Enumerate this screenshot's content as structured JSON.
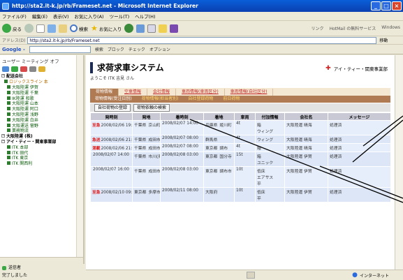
{
  "window": {
    "title": "http://sta2.it-k.jp/rb/Frameset.net - Microsoft Internet Explorer",
    "buttons": [
      "_",
      "□",
      "×"
    ]
  },
  "menu": [
    "ファイル(F)",
    "編集(E)",
    "表示(V)",
    "お気に入り(A)",
    "ツール(T)",
    "ヘルプ(H)"
  ],
  "toolbar": {
    "back": "戻る",
    "search": "検索",
    "favorites": "お気に入り",
    "right_links": [
      "リンク",
      "HotMail の無料サービス",
      "Windows"
    ]
  },
  "address": {
    "label": "アドレス(D)",
    "url": "http://sta2.it-k.jp/rb/Frameset.net",
    "go": "移動"
  },
  "googlebar": {
    "logo": "Google -",
    "items": [
      "検索",
      "ブロック",
      "チェック",
      "オプション"
    ]
  },
  "left": {
    "header": "ユーザー ミーティング オフ",
    "tree": [
      {
        "label": "配送会社",
        "level": 0,
        "root": true
      },
      {
        "label": "ロジックスライン 本",
        "level": 1,
        "sel": true
      },
      {
        "label": "大阪陸運 伊賀",
        "level": 2
      },
      {
        "label": "大阪陸運 千葉",
        "level": 2
      },
      {
        "label": "IK陸運 和歌",
        "level": 2
      },
      {
        "label": "大阪陸運 山本",
        "level": 2
      },
      {
        "label": "大阪陸運 阿口",
        "level": 2
      },
      {
        "label": "大阪陸運 浅野",
        "level": 2
      },
      {
        "label": "大阪陸運 白井",
        "level": 2
      },
      {
        "label": "大阪運送 菅野",
        "level": 2
      },
      {
        "label": "業務物流",
        "level": 2
      },
      {
        "label": "大阪陸運 (株)",
        "level": 0,
        "root": true
      },
      {
        "label": "アイ・ティー・関東事業部",
        "level": 0,
        "root": true
      },
      {
        "label": "ITK 本部",
        "level": 2
      },
      {
        "label": "ITK 田代",
        "level": 2
      },
      {
        "label": "ITK 東京",
        "level": 2
      },
      {
        "label": "ITK 関西利",
        "level": 2
      }
    ],
    "status": [
      "送信者",
      "完了しました"
    ]
  },
  "main": {
    "title": "求荷求車システム",
    "welcome": "ようこそ ITK 吉見 さん",
    "company": "アイ・ティー・関東事業部",
    "tabs": [
      {
        "label": "荷物情報",
        "current": true
      },
      {
        "label": "空車情報"
      },
      {
        "label": "会社情報"
      },
      {
        "label": "車両情報(車両区分)"
      },
      {
        "label": "車両情報(自社区分)"
      }
    ],
    "subtabs": [
      {
        "label": "荷物情報(受注日別)",
        "current": true
      },
      {
        "label": "荷物情報(担当者別)"
      },
      {
        "label": "自社登録荷物"
      },
      {
        "label": "前日荷物"
      }
    ],
    "actions": [
      "自社荷物の登録",
      "荷物依頼の検索"
    ],
    "columns": [
      "発時刻",
      "発地",
      "着時刻",
      "着地",
      "車両",
      "付加情報",
      "会社名",
      "メッセージ"
    ],
    "rows": [
      {
        "tag": "至急",
        "dep_time": "2008/02/06 19:30",
        "dep_place": "千葉県",
        "dep_city": "京山町",
        "arr_time": "2008/02/07 14:00",
        "arr_place": "兵庫県",
        "arr_city": "姫川町",
        "vehicle": "4t",
        "info": "箱\nウィング",
        "company": "大阪陸運 晴海",
        "message": "処理済"
      },
      {
        "tag": "急送",
        "dep_time": "2008/02/06 21:00",
        "dep_place": "千葉県",
        "dep_city": "成田市",
        "arr_time": "2008/02/07 08:00",
        "arr_place": "群馬県",
        "arr_city": "",
        "vehicle": "4t",
        "info": "ウィング",
        "company": "大阪陸運 晴海",
        "message": "処理済"
      },
      {
        "tag": "混載",
        "dep_time": "2008/02/06 21:00",
        "dep_place": "千葉県",
        "dep_city": "成田市",
        "arr_time": "2008/02/07 08:00",
        "arr_place": "東京都",
        "arr_city": "調布",
        "vehicle": "4t",
        "info": "箱",
        "company": "大阪陸運 晴海",
        "message": "処理済"
      },
      {
        "tag": "",
        "dep_time": "2008/02/07 14:00",
        "dep_place": "千葉県",
        "dep_city": "市川(東)",
        "arr_time": "2008/02/08 03:00",
        "arr_place": "東京都",
        "arr_city": "国分寺",
        "vehicle": "15t",
        "info": "箱\nユニック",
        "company": "大阪陸運 伊賀",
        "message": "処理済"
      },
      {
        "tag": "",
        "dep_time": "2008/02/07 16:00",
        "dep_place": "千葉県",
        "dep_city": "成田市",
        "arr_time": "2008/02/08 03:00",
        "arr_place": "東京都",
        "arr_city": "調布市",
        "vehicle": "10t",
        "info": "低床\nエアサス\n平",
        "company": "大阪陸運 伊賀",
        "message": "処理済"
      },
      {
        "tag": "至急",
        "dep_time": "2008/02/10 09:00",
        "dep_place": "東京都",
        "dep_city": "多摩市",
        "arr_time": "2008/02/11 08:00",
        "arr_place": "大阪府",
        "arr_city": "",
        "vehicle": "10t",
        "info": "低床\n平",
        "company": "大阪陸運 伊賀",
        "message": "処理済"
      }
    ]
  },
  "statusbar": {
    "zone": "インターネット"
  }
}
